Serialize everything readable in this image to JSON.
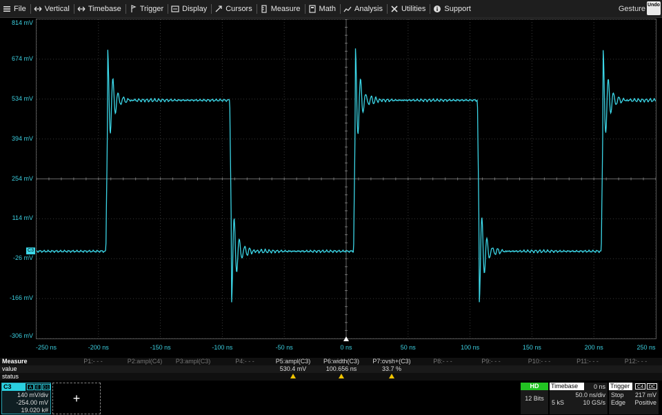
{
  "menu": {
    "items": [
      {
        "label": "File",
        "icon": "hamburger-icon"
      },
      {
        "label": "Vertical",
        "icon": "vertical-arrows-icon"
      },
      {
        "label": "Timebase",
        "icon": "horizontal-arrows-icon"
      },
      {
        "label": "Trigger",
        "icon": "trigger-flag-icon"
      },
      {
        "label": "Display",
        "icon": "display-icon"
      },
      {
        "label": "Cursors",
        "icon": "cursor-icon"
      },
      {
        "label": "Measure",
        "icon": "measure-icon"
      },
      {
        "label": "Math",
        "icon": "math-icon"
      },
      {
        "label": "Analysis",
        "icon": "analysis-icon"
      },
      {
        "label": "Utilities",
        "icon": "wrench-icon"
      },
      {
        "label": "Support",
        "icon": "info-icon"
      }
    ],
    "gesture": "Gesture",
    "undo": "Undo"
  },
  "trace_color": "#3cd7e8",
  "chart_data": {
    "type": "line",
    "x_ticks": [
      "-250 ns",
      "-200 ns",
      "-150 ns",
      "-100 ns",
      "-50 ns",
      "0 ns",
      "50 ns",
      "100 ns",
      "150 ns",
      "200 ns",
      "250 ns"
    ],
    "y_ticks": [
      "814 mV",
      "674 mV",
      "534 mV",
      "394 mV",
      "254 mV",
      "114 mV",
      "-26 mV",
      "-166 mV",
      "-306 mV"
    ],
    "xlim": [
      -250,
      250
    ],
    "ylim": [
      -306,
      814
    ],
    "x_unit": "ns",
    "y_unit": "mV",
    "grid": true,
    "waveform": {
      "shape": "square",
      "low_mV": 0,
      "high_mV": 530,
      "rise_edges_ns": [
        -194,
        6,
        206
      ],
      "fall_edges_ns": [
        -94,
        106
      ],
      "overshoot_peak_mV": 708,
      "undershoot_peak_mV": -178
    },
    "channel_marker": "C3"
  },
  "measure": {
    "title": "Measure",
    "row_value": "value",
    "row_status": "status",
    "params": [
      {
        "label": "P1:- - -",
        "value": "",
        "warn": false,
        "active": false
      },
      {
        "label": "P2:ampl(C4)",
        "value": "",
        "warn": false,
        "active": false
      },
      {
        "label": "P3:ampl(C3)",
        "value": "",
        "warn": false,
        "active": false
      },
      {
        "label": "P4:- - -",
        "value": "",
        "warn": false,
        "active": false
      },
      {
        "label": "P5:ampl(C3)",
        "value": "530.4 mV",
        "warn": true,
        "active": true
      },
      {
        "label": "P6:width(C3)",
        "value": "100.656 ns",
        "warn": true,
        "active": true
      },
      {
        "label": "P7:ovsh+(C3)",
        "value": "33.7 %",
        "warn": true,
        "active": true
      },
      {
        "label": "P8:- - -",
        "value": "",
        "warn": false,
        "active": false
      },
      {
        "label": "P9:- - -",
        "value": "",
        "warn": false,
        "active": false
      },
      {
        "label": "P10:- - -",
        "value": "",
        "warn": false,
        "active": false
      },
      {
        "label": "P11:- - -",
        "value": "",
        "warn": false,
        "active": false
      },
      {
        "label": "P12:- - -",
        "value": "",
        "warn": false,
        "active": false
      }
    ]
  },
  "channel": {
    "name": "C3",
    "tags": [
      "A",
      "E",
      "D1"
    ],
    "vdiv": "140 mV/div",
    "offset": "-254.00 mV",
    "count": "19.020 k#"
  },
  "add_label": "+",
  "acquisition": {
    "hd": "HD",
    "bits": "12 Bits"
  },
  "timebase": {
    "title": "Timebase",
    "delay": "0 ns",
    "tdiv": "50.0 ns/div",
    "samples": "5 kS",
    "rate": "10 GS/s"
  },
  "trigger": {
    "title": "Trigger",
    "channel_tag": "C4",
    "coupling_tag": "DC",
    "mode": "Stop",
    "level": "217 mV",
    "type": "Edge",
    "slope": "Positive"
  }
}
